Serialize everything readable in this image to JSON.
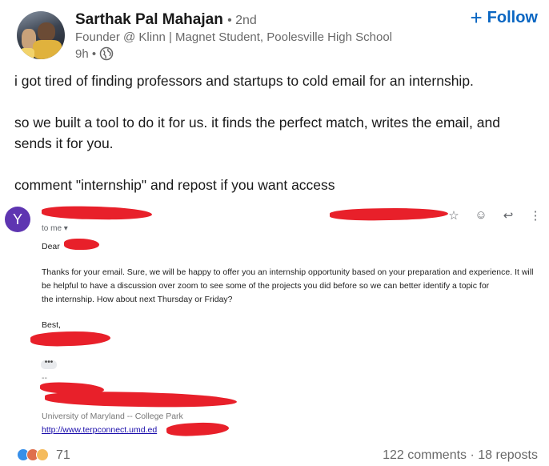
{
  "author": {
    "name": "Sarthak Pal Mahajan",
    "degree": "• 2nd",
    "headline": "Founder @ Klinn | Magnet Student, Poolesville High School",
    "time": "9h •",
    "visibility_icon": "globe-icon"
  },
  "follow_button": {
    "icon": "plus-icon",
    "label": "Follow",
    "color": "#0a66c2"
  },
  "post": {
    "paragraphs": [
      "i got tired of finding professors and startups to cold email for an internship.",
      "so we built a tool to do it for us. it finds the perfect match, writes the email, and sends it for you.",
      "comment \"internship\" and repost if you want access"
    ]
  },
  "email_image": {
    "sender_initial": "Y",
    "sender_avatar_color": "#5e35b1",
    "to_label": "to me ▾",
    "greeting": "Dear",
    "body_lines": [
      "Thanks for your email. Sure, we will be happy to offer you an internship opportunity based on your preparation and experience. It will",
      "be helpful to have a discussion over zoom to see some of the projects you did before so we can better identify a topic for",
      "the internship. How about next Thursday or Friday?"
    ],
    "signoff": "Best,",
    "dashes": "--",
    "university": "University of Maryland -- College Park",
    "link": "http://www.terpconnect.umd.ed",
    "icons": [
      "star-icon",
      "emoji-icon",
      "reply-icon",
      "more-icon"
    ]
  },
  "footer": {
    "reaction_count": "71",
    "comments": "122 comments",
    "separator": "·",
    "reposts": "18 reposts"
  }
}
